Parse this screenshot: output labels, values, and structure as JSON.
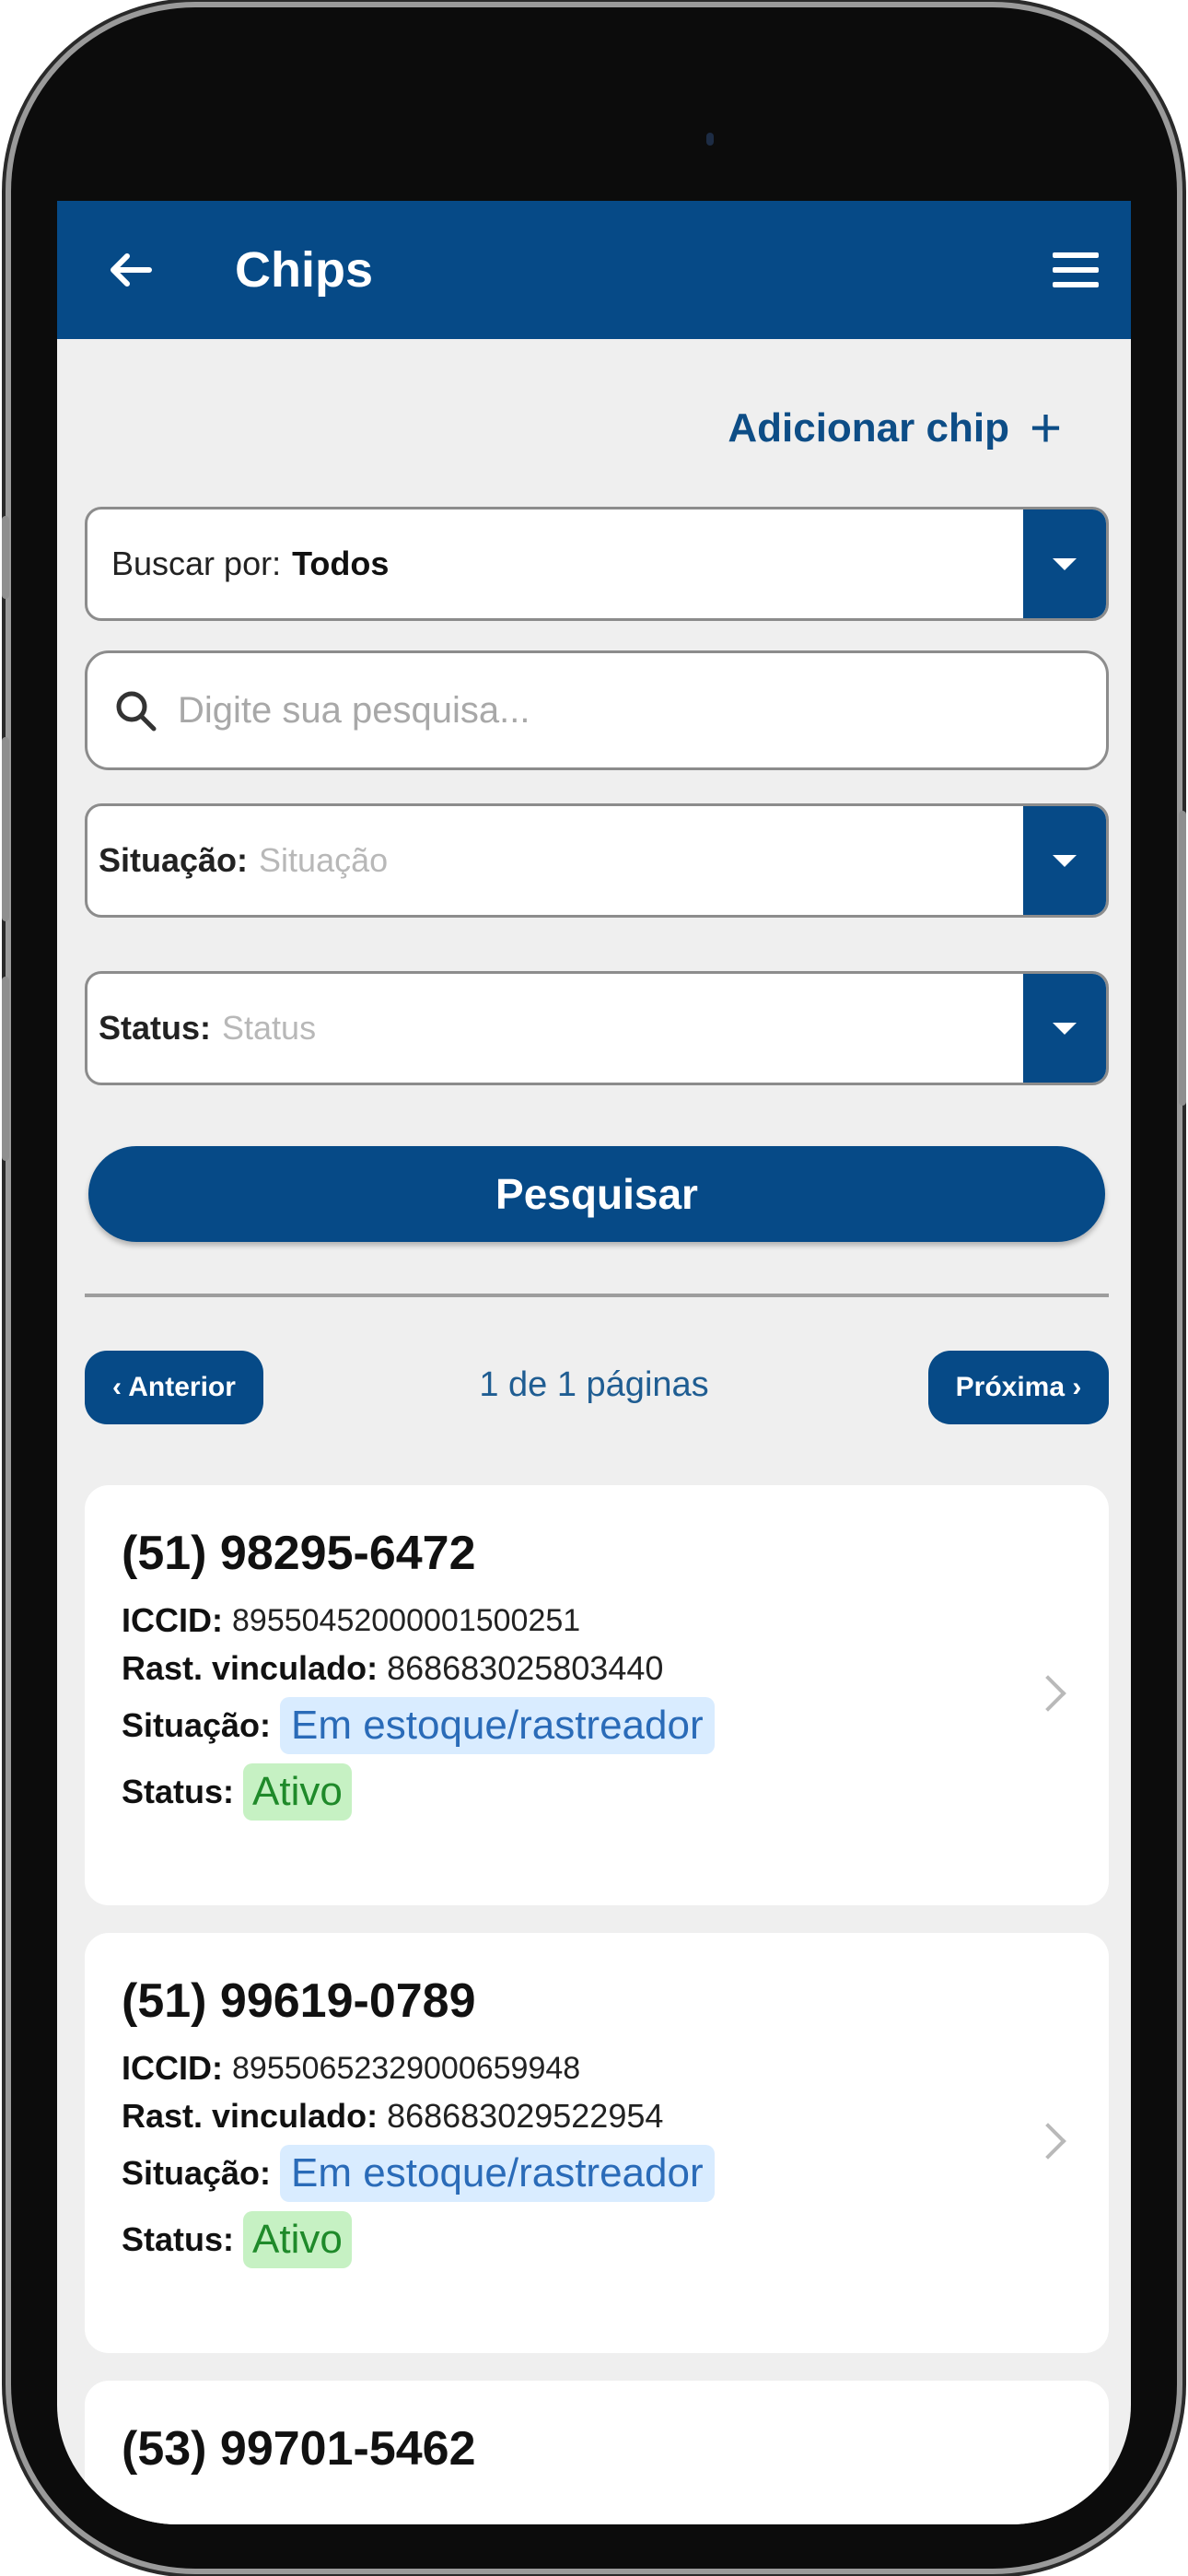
{
  "app_bar": {
    "title": "Chips"
  },
  "actions": {
    "add_chip_label": "Adicionar chip",
    "add_icon": "plus-icon"
  },
  "filters": {
    "buscar_por": {
      "label": "Buscar por:",
      "value": "Todos"
    },
    "search": {
      "placeholder": "Digite sua pesquisa..."
    },
    "situacao": {
      "label": "Situação:",
      "placeholder": "Situação"
    },
    "status": {
      "label": "Status:",
      "placeholder": "Status"
    },
    "submit_label": "Pesquisar"
  },
  "pagination": {
    "prev_label": "‹ Anterior",
    "info": "1 de 1 páginas",
    "next_label": "Próxima ›"
  },
  "field_labels": {
    "iccid": "ICCID:",
    "rast": "Rast. vinculado:",
    "situacao": "Situação:",
    "status": "Status:"
  },
  "chips": [
    {
      "phone": "(51) 98295-6472",
      "iccid": "89550452000001500251",
      "rast": "868683025803440",
      "situacao": "Em estoque/rastreador",
      "status": "Ativo"
    },
    {
      "phone": "(51) 99619-0789",
      "iccid": "89550652329000659948",
      "rast": "868683029522954",
      "situacao": "Em estoque/rastreador",
      "status": "Ativo"
    },
    {
      "phone": "(53) 99701-5462"
    }
  ],
  "colors": {
    "primary": "#064a87",
    "situacao_badge_bg": "#d9ecff",
    "status_badge_bg": "#c6f1c3"
  }
}
